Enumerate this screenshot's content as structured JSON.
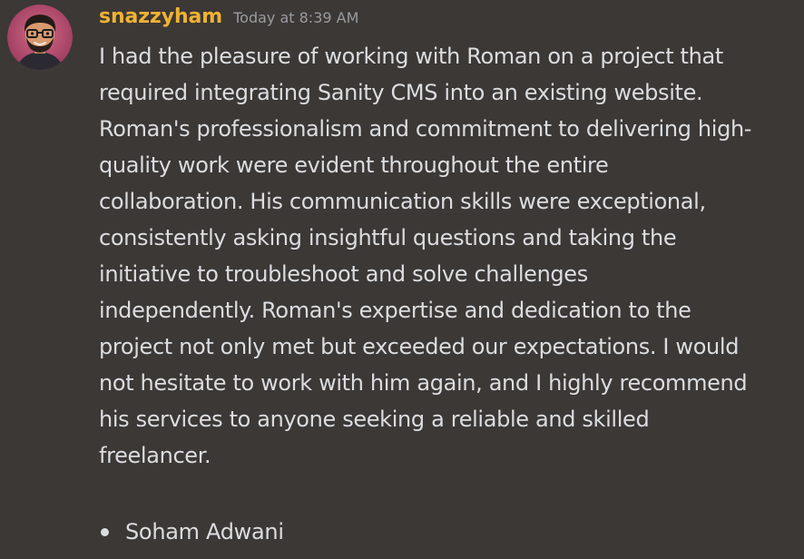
{
  "message": {
    "username": "snazzyham",
    "timestamp": "Today at 8:39 AM",
    "avatar_icon": "cartoon-avatar-icon",
    "lines": [
      "I had the pleasure of working with Roman on a project that",
      "required integrating Sanity CMS into an existing website.",
      "Roman's professionalism and commitment to delivering high-",
      "quality work were evident throughout the entire",
      "collaboration. His communication skills were exceptional,",
      "consistently asking insightful questions and taking the",
      "initiative to troubleshoot and solve challenges",
      "independently. Roman's expertise and dedication to the",
      "project not only met but exceeded our expectations. I would",
      "not hesitate to work with him again, and I highly recommend",
      "his services to anyone seeking a reliable and skilled",
      "freelancer."
    ],
    "bullets": [
      "Soham Adwani"
    ]
  },
  "colors": {
    "background": "#3b3836",
    "username": "#f0b232",
    "text": "#dcdde0",
    "timestamp": "#9a9b9f"
  }
}
